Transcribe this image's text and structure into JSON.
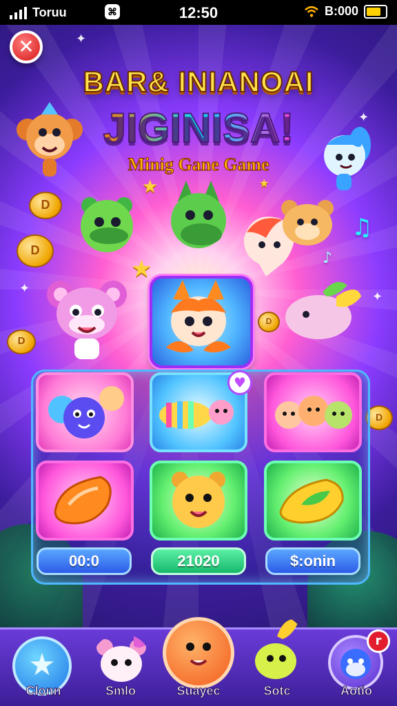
{
  "status_bar": {
    "carrier": "Toruu",
    "time": "12:50",
    "balance": "B:000",
    "center_icon": "⌘"
  },
  "header": {
    "close_icon": "close-icon",
    "title_line1": "BAR& INIANOAI",
    "title_line2": "JIGINISA!",
    "subtitle": "Minig Gane Game"
  },
  "colors": {
    "accent_blue": "#2c5be8",
    "accent_green": "#17b86b",
    "badge_red": "#e11d2e"
  },
  "grid": {
    "tiles": [
      {
        "name": "character-group-tile",
        "icon": "monster-group-icon"
      },
      {
        "name": "striped-ball-tile",
        "icon": "striped-fish-icon"
      },
      {
        "name": "kittens-tile",
        "icon": "kittens-icon"
      },
      {
        "name": "orange-gem-tile",
        "icon": "orange-gem-icon"
      },
      {
        "name": "lion-tile",
        "icon": "lion-icon"
      },
      {
        "name": "green-gem-tile",
        "icon": "green-gem-icon"
      }
    ],
    "values": [
      "00:0",
      "21020",
      "$:onin"
    ]
  },
  "bottom_nav": {
    "items": [
      {
        "label": "Clonn",
        "icon": "star-icon"
      },
      {
        "label": "Smlo",
        "icon": "cat-icon"
      },
      {
        "label": "Suayec",
        "icon": "orange-blob-icon"
      },
      {
        "label": "Sotc",
        "icon": "fish-icon"
      },
      {
        "label": "Aotio",
        "icon": "blue-pet-icon",
        "badge": "r"
      }
    ]
  },
  "coins": [
    "D",
    "D",
    "D",
    "D"
  ],
  "heart_badge": "♥"
}
